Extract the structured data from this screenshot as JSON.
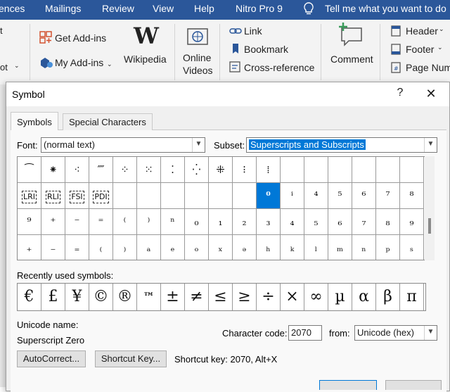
{
  "ribbon_tabs": [
    "ences",
    "Mailings",
    "Review",
    "View",
    "Help",
    "Nitro Pro 9",
    "Tell me what you want to do"
  ],
  "ribbon": {
    "get_addins": "Get Add-ins",
    "my_addins": "My Add-ins",
    "wikipedia_letter": "W",
    "wikipedia": "Wikipedia",
    "online_videos_1": "Online",
    "online_videos_2": "Videos",
    "link": "Link",
    "bookmark": "Bookmark",
    "cross_reference": "Cross-reference",
    "comment": "Comment",
    "header": "Header",
    "footer": "Footer",
    "page_number": "Page Num",
    "left_fragment": "ot",
    "left_fragment_top": "t"
  },
  "dialog": {
    "title": "Symbol",
    "help": "?",
    "close": "✕",
    "tabs": [
      "Symbols",
      "Special Characters"
    ],
    "font_label": "Font:",
    "font_value": "(normal text)",
    "subset_label": "Subset:",
    "subset_value": "Superscripts and Subscripts",
    "grid_rows": [
      [
        "⁀",
        "⁕",
        "⁖",
        "⁗",
        "⁘",
        "⁙",
        "⁚",
        "⁛",
        "⁜",
        "⁝",
        "⁞",
        "",
        "",
        "",
        "",
        "",
        ""
      ],
      [
        "LRI",
        "RLI",
        "FSI",
        "PDI",
        "",
        "",
        "",
        "",
        "",
        "",
        "⁰",
        "ⁱ",
        "⁴",
        "⁵",
        "⁶",
        "⁷",
        "⁸"
      ],
      [
        "⁹",
        "⁺",
        "⁻",
        "⁼",
        "⁽",
        "⁾",
        "ⁿ",
        "₀",
        "₁",
        "₂",
        "₃",
        "₄",
        "₅",
        "₆",
        "₇",
        "₈",
        "₉"
      ],
      [
        "₊",
        "₋",
        "₌",
        "₍",
        "₎",
        "ₐ",
        "ₑ",
        "ₒ",
        "ₓ",
        "ₔ",
        "ₕ",
        "ₖ",
        "ₗ",
        "ₘ",
        "ₙ",
        "ₚ",
        "ₛ"
      ]
    ],
    "recent_label": "Recently used symbols:",
    "recent_symbols": [
      "€",
      "£",
      "¥",
      "©",
      "®",
      "™",
      "±",
      "≠",
      "≤",
      "≥",
      "÷",
      "×",
      "∞",
      "µ",
      "α",
      "β",
      "π"
    ],
    "unicode_name_label": "Unicode name:",
    "unicode_name_value": "Superscript Zero",
    "char_code_label": "Character code:",
    "char_code_value": "2070",
    "from_label": "from:",
    "from_value": "Unicode (hex)",
    "autocorrect_button": "AutoCorrect...",
    "shortcut_key_button": "Shortcut Key...",
    "shortcut_key_text": "Shortcut key: 2070, Alt+X"
  },
  "colors": {
    "ribbon_blue": "#2b579a",
    "selection_blue": "#0078d7",
    "dialog_bg": "#f0f0f0"
  }
}
